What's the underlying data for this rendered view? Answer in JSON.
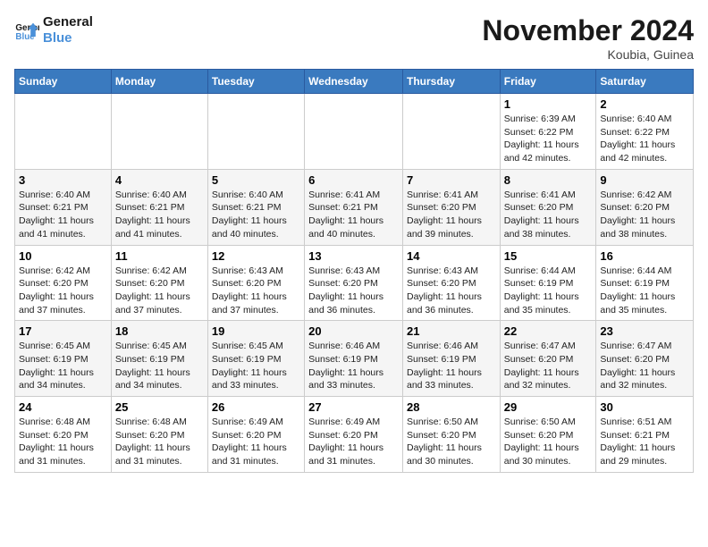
{
  "logo": {
    "line1": "General",
    "line2": "Blue"
  },
  "title": "November 2024",
  "subtitle": "Koubia, Guinea",
  "days_of_week": [
    "Sunday",
    "Monday",
    "Tuesday",
    "Wednesday",
    "Thursday",
    "Friday",
    "Saturday"
  ],
  "weeks": [
    [
      {
        "day": "",
        "info": ""
      },
      {
        "day": "",
        "info": ""
      },
      {
        "day": "",
        "info": ""
      },
      {
        "day": "",
        "info": ""
      },
      {
        "day": "",
        "info": ""
      },
      {
        "day": "1",
        "info": "Sunrise: 6:39 AM\nSunset: 6:22 PM\nDaylight: 11 hours and 42 minutes."
      },
      {
        "day": "2",
        "info": "Sunrise: 6:40 AM\nSunset: 6:22 PM\nDaylight: 11 hours and 42 minutes."
      }
    ],
    [
      {
        "day": "3",
        "info": "Sunrise: 6:40 AM\nSunset: 6:21 PM\nDaylight: 11 hours and 41 minutes."
      },
      {
        "day": "4",
        "info": "Sunrise: 6:40 AM\nSunset: 6:21 PM\nDaylight: 11 hours and 41 minutes."
      },
      {
        "day": "5",
        "info": "Sunrise: 6:40 AM\nSunset: 6:21 PM\nDaylight: 11 hours and 40 minutes."
      },
      {
        "day": "6",
        "info": "Sunrise: 6:41 AM\nSunset: 6:21 PM\nDaylight: 11 hours and 40 minutes."
      },
      {
        "day": "7",
        "info": "Sunrise: 6:41 AM\nSunset: 6:20 PM\nDaylight: 11 hours and 39 minutes."
      },
      {
        "day": "8",
        "info": "Sunrise: 6:41 AM\nSunset: 6:20 PM\nDaylight: 11 hours and 38 minutes."
      },
      {
        "day": "9",
        "info": "Sunrise: 6:42 AM\nSunset: 6:20 PM\nDaylight: 11 hours and 38 minutes."
      }
    ],
    [
      {
        "day": "10",
        "info": "Sunrise: 6:42 AM\nSunset: 6:20 PM\nDaylight: 11 hours and 37 minutes."
      },
      {
        "day": "11",
        "info": "Sunrise: 6:42 AM\nSunset: 6:20 PM\nDaylight: 11 hours and 37 minutes."
      },
      {
        "day": "12",
        "info": "Sunrise: 6:43 AM\nSunset: 6:20 PM\nDaylight: 11 hours and 37 minutes."
      },
      {
        "day": "13",
        "info": "Sunrise: 6:43 AM\nSunset: 6:20 PM\nDaylight: 11 hours and 36 minutes."
      },
      {
        "day": "14",
        "info": "Sunrise: 6:43 AM\nSunset: 6:20 PM\nDaylight: 11 hours and 36 minutes."
      },
      {
        "day": "15",
        "info": "Sunrise: 6:44 AM\nSunset: 6:19 PM\nDaylight: 11 hours and 35 minutes."
      },
      {
        "day": "16",
        "info": "Sunrise: 6:44 AM\nSunset: 6:19 PM\nDaylight: 11 hours and 35 minutes."
      }
    ],
    [
      {
        "day": "17",
        "info": "Sunrise: 6:45 AM\nSunset: 6:19 PM\nDaylight: 11 hours and 34 minutes."
      },
      {
        "day": "18",
        "info": "Sunrise: 6:45 AM\nSunset: 6:19 PM\nDaylight: 11 hours and 34 minutes."
      },
      {
        "day": "19",
        "info": "Sunrise: 6:45 AM\nSunset: 6:19 PM\nDaylight: 11 hours and 33 minutes."
      },
      {
        "day": "20",
        "info": "Sunrise: 6:46 AM\nSunset: 6:19 PM\nDaylight: 11 hours and 33 minutes."
      },
      {
        "day": "21",
        "info": "Sunrise: 6:46 AM\nSunset: 6:19 PM\nDaylight: 11 hours and 33 minutes."
      },
      {
        "day": "22",
        "info": "Sunrise: 6:47 AM\nSunset: 6:20 PM\nDaylight: 11 hours and 32 minutes."
      },
      {
        "day": "23",
        "info": "Sunrise: 6:47 AM\nSunset: 6:20 PM\nDaylight: 11 hours and 32 minutes."
      }
    ],
    [
      {
        "day": "24",
        "info": "Sunrise: 6:48 AM\nSunset: 6:20 PM\nDaylight: 11 hours and 31 minutes."
      },
      {
        "day": "25",
        "info": "Sunrise: 6:48 AM\nSunset: 6:20 PM\nDaylight: 11 hours and 31 minutes."
      },
      {
        "day": "26",
        "info": "Sunrise: 6:49 AM\nSunset: 6:20 PM\nDaylight: 11 hours and 31 minutes."
      },
      {
        "day": "27",
        "info": "Sunrise: 6:49 AM\nSunset: 6:20 PM\nDaylight: 11 hours and 31 minutes."
      },
      {
        "day": "28",
        "info": "Sunrise: 6:50 AM\nSunset: 6:20 PM\nDaylight: 11 hours and 30 minutes."
      },
      {
        "day": "29",
        "info": "Sunrise: 6:50 AM\nSunset: 6:20 PM\nDaylight: 11 hours and 30 minutes."
      },
      {
        "day": "30",
        "info": "Sunrise: 6:51 AM\nSunset: 6:21 PM\nDaylight: 11 hours and 29 minutes."
      }
    ]
  ]
}
